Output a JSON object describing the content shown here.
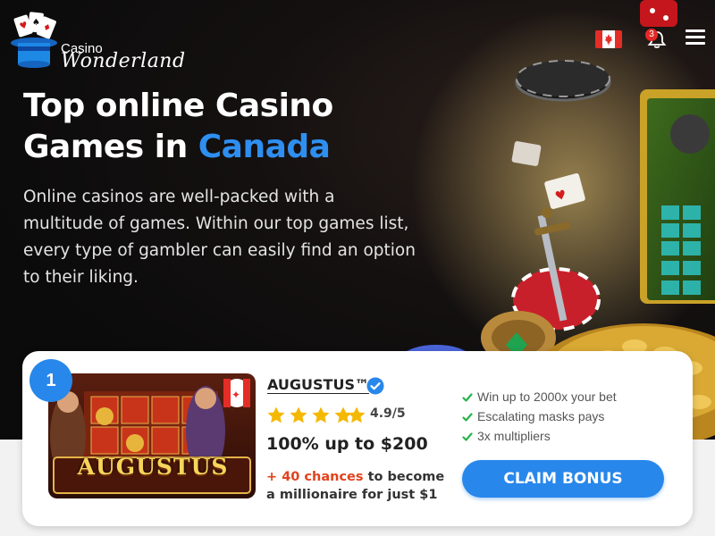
{
  "header": {
    "logo_small": "Casino",
    "logo_big": "Wonderland",
    "notifications_count": "3",
    "country_flag": "canada-flag-icon",
    "menu_icon": "hamburger-menu-icon"
  },
  "hero": {
    "title_line1": "Top online Casino",
    "title_line2_prefix": "Games in ",
    "title_line2_accent": "Canada",
    "description": "Online casinos are well-packed with a multitude of games. Within our top games list, every type of gambler can easily find an option to their liking."
  },
  "listing": {
    "rank": "1",
    "game_thumbnail_text": "AUGUSTUS",
    "brand_name": "AUGUSTUS™",
    "rating_stars": 5,
    "rating_text": "4.9/5",
    "bonus": "100% up to $200",
    "offer_highlight": "+ 40 chances",
    "offer_rest": " to become a millionaire for just $1",
    "features": [
      "Win up to 2000x your bet",
      "Escalating masks pays",
      "3x multipliers"
    ],
    "cta": "CLAIM BONUS"
  },
  "colors": {
    "accent_blue": "#2887ea",
    "title_accent": "#2e8ff0",
    "offer_highlight": "#e2421c",
    "star": "#f5b800",
    "check": "#27b34a"
  }
}
